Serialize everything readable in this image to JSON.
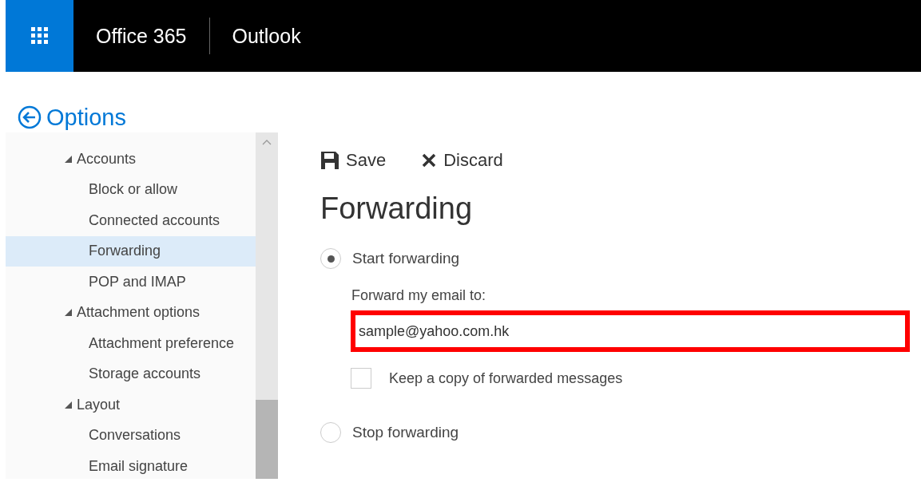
{
  "header": {
    "brand": "Office 365",
    "app": "Outlook"
  },
  "options_title": "Options",
  "sidebar": {
    "items": [
      {
        "label": "Accounts",
        "selected": false,
        "expanded": true,
        "children": [
          {
            "label": "Block or allow",
            "selected": false
          },
          {
            "label": "Connected accounts",
            "selected": false
          },
          {
            "label": "Forwarding",
            "selected": true
          },
          {
            "label": "POP and IMAP",
            "selected": false
          }
        ]
      },
      {
        "label": "Attachment options",
        "selected": false,
        "expanded": true,
        "children": [
          {
            "label": "Attachment preference",
            "selected": false
          },
          {
            "label": "Storage accounts",
            "selected": false
          }
        ]
      },
      {
        "label": "Layout",
        "selected": false,
        "expanded": true,
        "children": [
          {
            "label": "Conversations",
            "selected": false
          },
          {
            "label": "Email signature",
            "selected": false
          }
        ]
      }
    ]
  },
  "toolbar": {
    "save": "Save",
    "discard": "Discard"
  },
  "heading": "Forwarding",
  "start_option": {
    "label": "Start forwarding",
    "selected": true
  },
  "forward_field": {
    "label": "Forward my email to:",
    "value": "sample@yahoo.com.hk",
    "highlighted": true
  },
  "keep_copy": {
    "label": "Keep a copy of forwarded messages",
    "checked": false
  },
  "stop_option": {
    "label": "Stop forwarding",
    "selected": false
  }
}
